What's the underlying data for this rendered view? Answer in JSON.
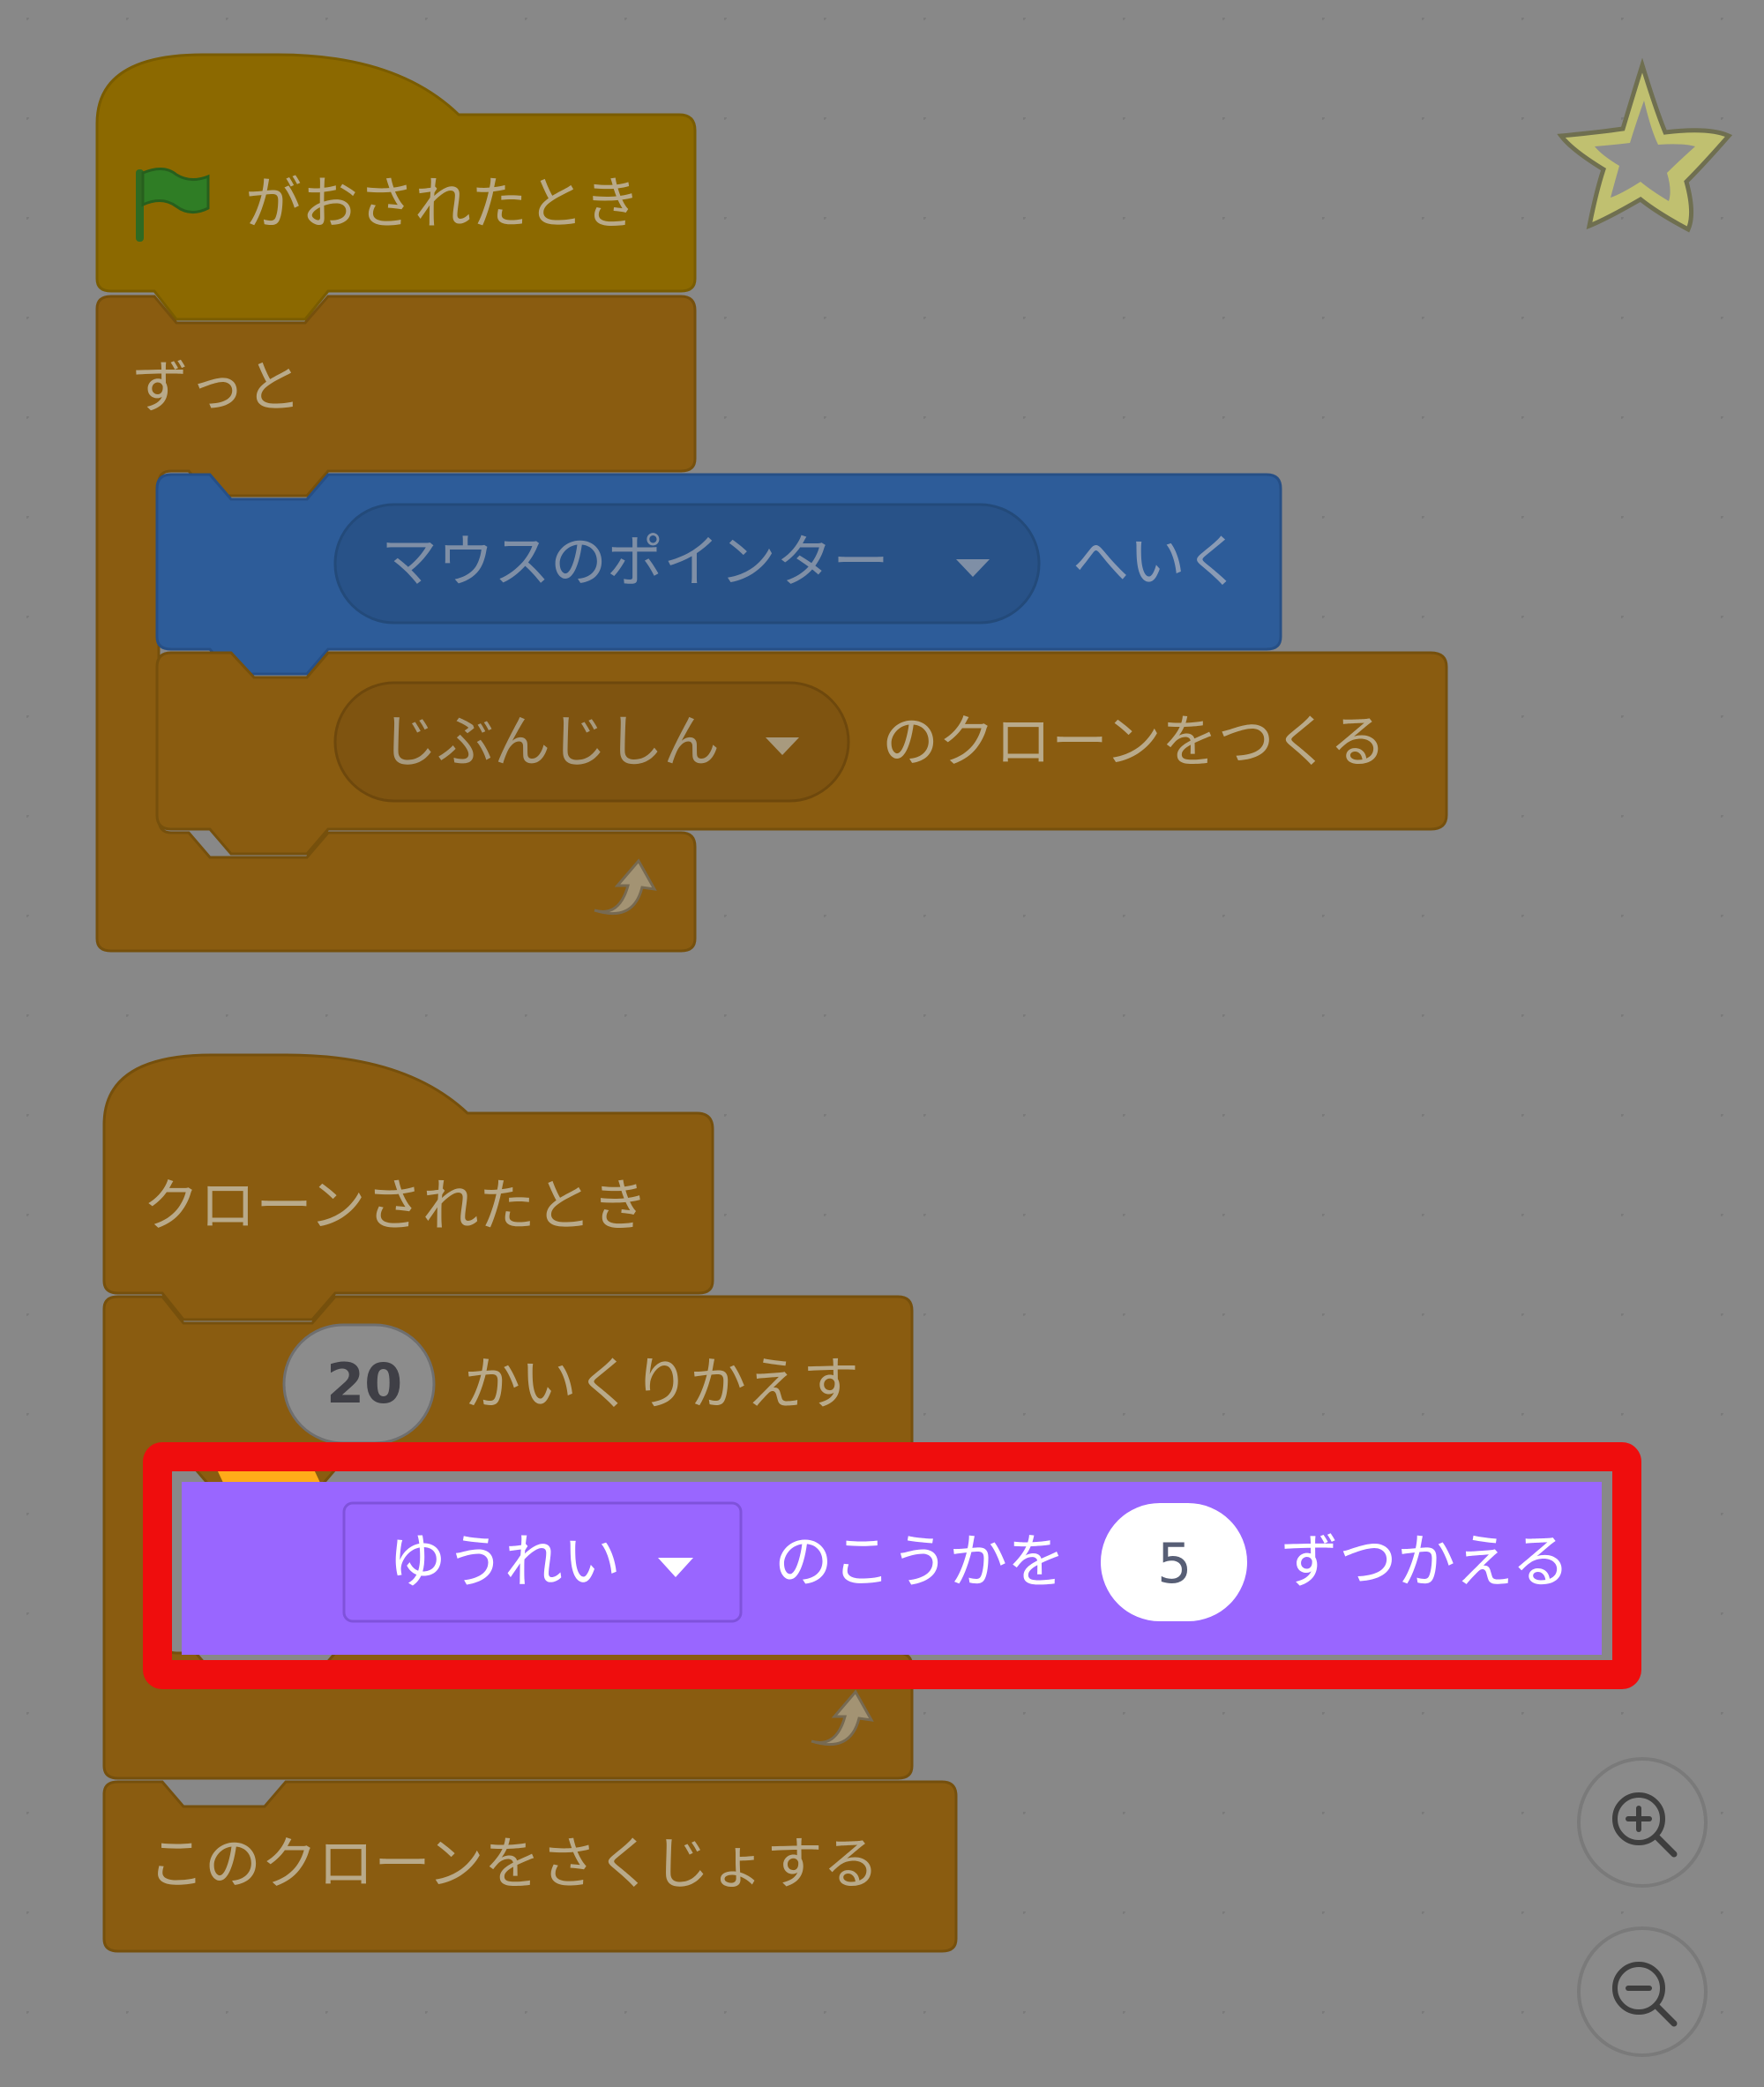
{
  "script1": {
    "hat_label": "がおされたとき",
    "forever_label": "ずっと",
    "goto_dropdown": "マウスのポインター",
    "goto_suffix": "へいく",
    "clone_dropdown": "じぶんじしん",
    "clone_suffix": "のクローンをつくる"
  },
  "script2": {
    "hat_label": "クローンされたとき",
    "repeat_count": "20",
    "repeat_label": "かいくりかえす",
    "effect_dropdown": "ゆうれい",
    "effect_middle": "のこうかを",
    "effect_value": "5",
    "effect_suffix": "ずつかえる",
    "delete_label": "このクローンをさくじょする"
  },
  "colors": {
    "background": "#888888",
    "control_dimmed": "#8a5c10",
    "events_dimmed": "#8c6900",
    "motion_dimmed": "#2d5c99",
    "looks_highlighted": "#9966ff",
    "highlight_border": "#ef0d0d"
  },
  "icons": {
    "green_flag": "green-flag-icon",
    "loop_arrow": "loop-arrow-icon",
    "dropdown_caret": "caret-down-icon",
    "sprite_star": "star-icon",
    "zoom_in": "zoom-in-icon",
    "zoom_out": "zoom-out-icon"
  }
}
